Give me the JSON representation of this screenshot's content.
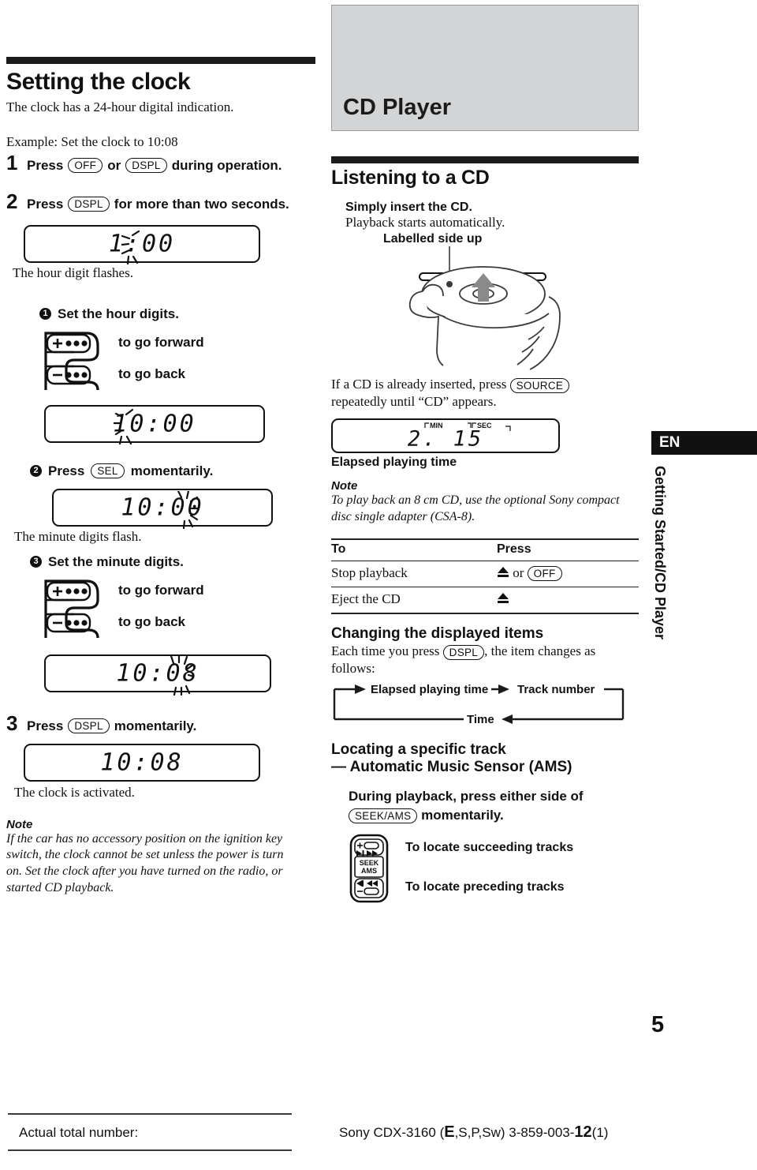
{
  "meta": {
    "page_number": "5",
    "language_tab": "EN",
    "running_head": "Getting Started/CD Player"
  },
  "left": {
    "title": "Setting the clock",
    "intro": "The clock has a 24-hour digital indication.",
    "example": "Example: Set the clock to 10:08",
    "step1": {
      "num": "1",
      "pre": "Press",
      "btn1": "OFF",
      "mid": "or",
      "btn2": "DSPL",
      "post": "during operation."
    },
    "step2": {
      "num": "2",
      "pre": "Press",
      "btn1": "DSPL",
      "post": "for more than two seconds."
    },
    "lcd_hour_flash": {
      "value": "1:00",
      "caption": "The hour digit flashes."
    },
    "substep1": {
      "marker": "1",
      "label": "Set the hour digits.",
      "forward": "to go forward",
      "back": "to go back"
    },
    "lcd_1000_left": {
      "value": "10:00"
    },
    "substep2": {
      "marker": "2",
      "pre": "Press",
      "btn": "SEL",
      "post": "momentarily.",
      "caption": "The minute digits flash."
    },
    "lcd_1000_right": {
      "value": "10:00"
    },
    "substep3": {
      "marker": "3",
      "label": "Set the minute digits.",
      "forward": "to go forward",
      "back": "to go back"
    },
    "lcd_1008_flash": {
      "value": "10:08"
    },
    "step3": {
      "num": "3",
      "pre": "Press",
      "btn1": "DSPL",
      "post": "momentarily."
    },
    "lcd_1008": {
      "value": "10:08",
      "caption": "The clock is activated."
    },
    "note": {
      "label": "Note",
      "text": "If the car has no accessory position on the ignition key switch, the clock cannot be set unless the power is turn on. Set the clock after you have turned on the radio, or started CD playback."
    },
    "rotary_plus": "+",
    "rotary_minus": "–"
  },
  "right": {
    "banner_title": "CD Player",
    "section_title": "Listening to a CD",
    "insert_bold": "Simply insert the CD.",
    "insert_serif": "Playback starts automatically.",
    "labelled_side_up": "Labelled side up",
    "already_inserted": {
      "pre": "If a CD is already inserted, press",
      "btn": "SOURCE",
      "post": "repeatedly until “CD” appears."
    },
    "lcd_elapsed": {
      "min_label": "MIN",
      "sec_label": "SEC",
      "value": "2. 15",
      "caption": "Elapsed playing time"
    },
    "note": {
      "label": "Note",
      "text": "To play back an 8 cm CD, use the optional Sony compact disc single adapter (CSA-8)."
    },
    "table": {
      "headers": [
        "To",
        "Press"
      ],
      "rows": [
        {
          "to": "Stop playback",
          "press_icon": "eject-icon",
          "press_mid": "or",
          "press_btn": "OFF"
        },
        {
          "to": "Eject the CD",
          "press_icon": "eject-icon",
          "press_mid": "",
          "press_btn": ""
        }
      ]
    },
    "changing": {
      "title": "Changing the displayed items",
      "pre": "Each time you press",
      "btn": "DSPL",
      "post": ", the item changes as follows:",
      "flow": [
        "Elapsed playing time",
        "Track number",
        "Time"
      ]
    },
    "locating": {
      "title": "Locating a specific track",
      "subtitle": "— Automatic Music Sensor (AMS)",
      "instruction_pre": "During playback, press either side of",
      "btn": "SEEK/AMS",
      "instruction_post": "momentarily.",
      "succeeding": "To locate succeeding tracks",
      "preceding": "To locate preceding tracks",
      "seek_label_line1": "SEEK",
      "seek_label_line2": "AMS"
    }
  },
  "footer": {
    "left_label": "Actual total number:",
    "right_pre": "Sony CDX-3160 (",
    "right_bold_e": "E",
    "right_mid": ",S,P,Sw)  3-859-003-",
    "right_bold_12": "12",
    "right_post": "(1)"
  }
}
